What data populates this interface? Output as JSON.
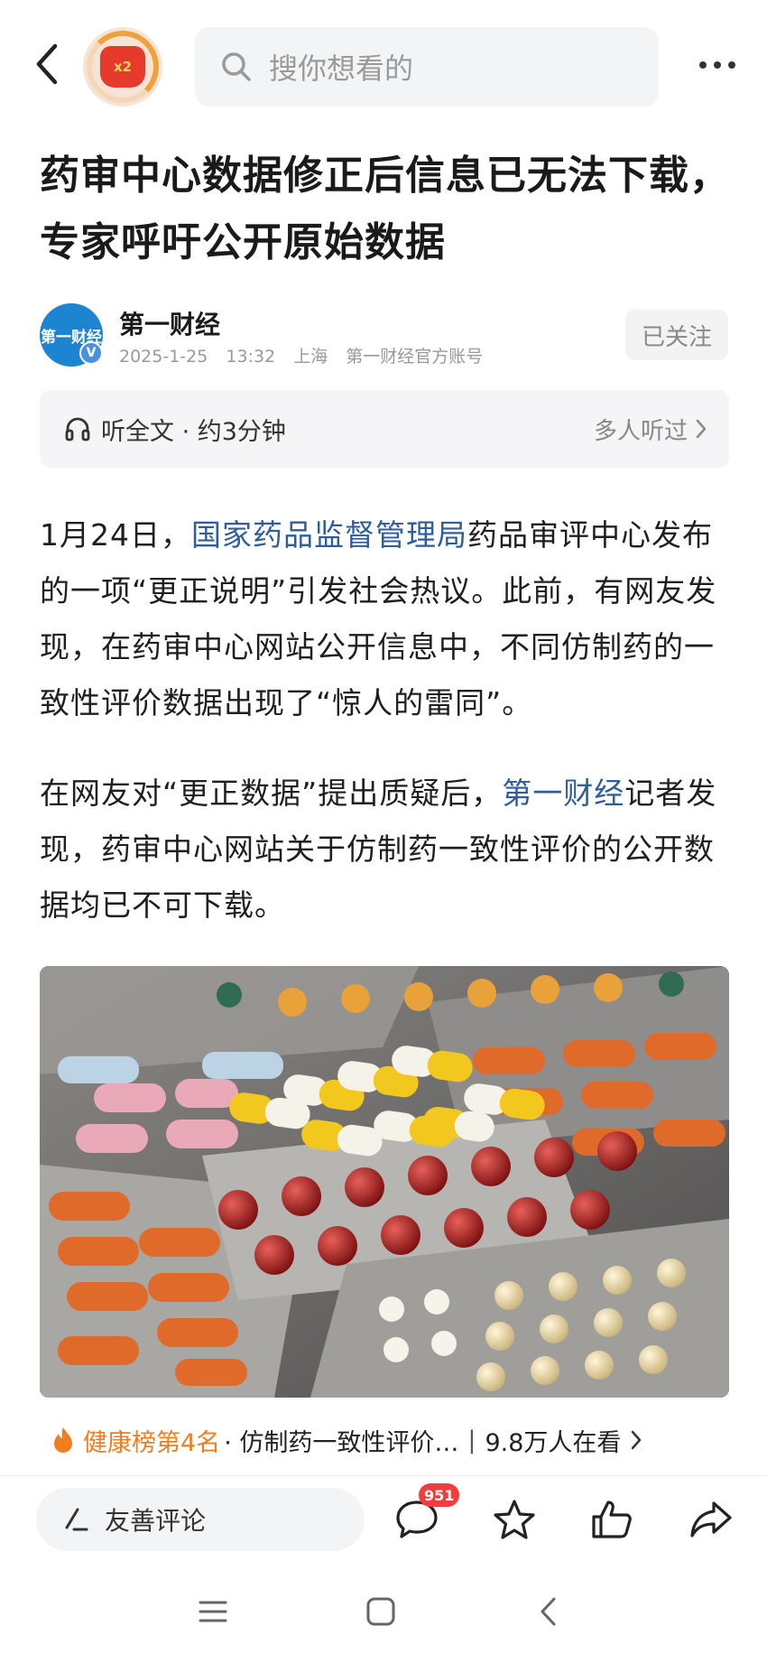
{
  "header": {
    "search_placeholder": "搜你想看的",
    "reward_badge_text": "x2"
  },
  "article": {
    "title": "药审中心数据修正后信息已无法下载，专家呼吁公开原始数据",
    "author": {
      "name": "第一财经",
      "avatar_text": "第一财经",
      "verified_mark": "V",
      "date": "2025-1-25",
      "time": "13:32",
      "location": "上海",
      "account_type": "第一财经官方账号",
      "follow_label": "已关注"
    },
    "listen": {
      "label": "听全文 · 约3分钟",
      "right_label": "多人听过"
    },
    "paragraphs": [
      {
        "before": "1月24日，",
        "link": "国家药品监督管理局",
        "after": "药品审评中心发布的一项“更正说明”引发社会热议。此前，有网友发现，在药审中心网站公开信息中，不同仿制药的一致性评价数据出现了“惊人的雷同”。"
      },
      {
        "before": "在网友对“更正数据”提出质疑后，",
        "link": "第一财经",
        "after": "记者发现，药审中心网站关于仿制药一致性评价的公开数据均已不可下载。"
      }
    ]
  },
  "hot_list": {
    "rank": "健康榜第4名",
    "topic": "· 仿制药一致性评价…",
    "views": "9.8万人在看"
  },
  "action_bar": {
    "comment_placeholder": "友善评论",
    "comment_count": "951"
  },
  "icons": {
    "back": "back-arrow-icon",
    "search": "search-icon",
    "more": "more-dots-icon",
    "headphones": "headphones-icon",
    "fire": "fire-icon",
    "pen": "pen-icon",
    "comment": "comment-bubble-icon",
    "star": "star-icon",
    "like": "thumbs-up-icon",
    "share": "share-arrow-icon"
  },
  "colors": {
    "link": "#2d5d9c",
    "hot_rank": "#f07d1e",
    "badge": "#f23d3d",
    "reward_bag": "#e63a2d"
  }
}
